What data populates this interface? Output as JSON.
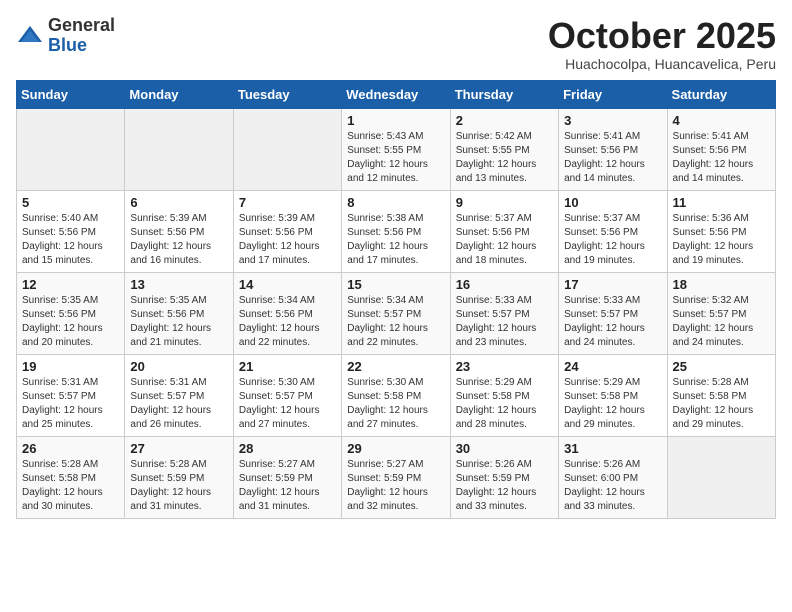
{
  "header": {
    "logo_general": "General",
    "logo_blue": "Blue",
    "month_title": "October 2025",
    "location": "Huachocolpa, Huancavelica, Peru"
  },
  "days_of_week": [
    "Sunday",
    "Monday",
    "Tuesday",
    "Wednesday",
    "Thursday",
    "Friday",
    "Saturday"
  ],
  "weeks": [
    [
      {
        "day": "",
        "info": ""
      },
      {
        "day": "",
        "info": ""
      },
      {
        "day": "",
        "info": ""
      },
      {
        "day": "1",
        "info": "Sunrise: 5:43 AM\nSunset: 5:55 PM\nDaylight: 12 hours\nand 12 minutes."
      },
      {
        "day": "2",
        "info": "Sunrise: 5:42 AM\nSunset: 5:55 PM\nDaylight: 12 hours\nand 13 minutes."
      },
      {
        "day": "3",
        "info": "Sunrise: 5:41 AM\nSunset: 5:56 PM\nDaylight: 12 hours\nand 14 minutes."
      },
      {
        "day": "4",
        "info": "Sunrise: 5:41 AM\nSunset: 5:56 PM\nDaylight: 12 hours\nand 14 minutes."
      }
    ],
    [
      {
        "day": "5",
        "info": "Sunrise: 5:40 AM\nSunset: 5:56 PM\nDaylight: 12 hours\nand 15 minutes."
      },
      {
        "day": "6",
        "info": "Sunrise: 5:39 AM\nSunset: 5:56 PM\nDaylight: 12 hours\nand 16 minutes."
      },
      {
        "day": "7",
        "info": "Sunrise: 5:39 AM\nSunset: 5:56 PM\nDaylight: 12 hours\nand 17 minutes."
      },
      {
        "day": "8",
        "info": "Sunrise: 5:38 AM\nSunset: 5:56 PM\nDaylight: 12 hours\nand 17 minutes."
      },
      {
        "day": "9",
        "info": "Sunrise: 5:37 AM\nSunset: 5:56 PM\nDaylight: 12 hours\nand 18 minutes."
      },
      {
        "day": "10",
        "info": "Sunrise: 5:37 AM\nSunset: 5:56 PM\nDaylight: 12 hours\nand 19 minutes."
      },
      {
        "day": "11",
        "info": "Sunrise: 5:36 AM\nSunset: 5:56 PM\nDaylight: 12 hours\nand 19 minutes."
      }
    ],
    [
      {
        "day": "12",
        "info": "Sunrise: 5:35 AM\nSunset: 5:56 PM\nDaylight: 12 hours\nand 20 minutes."
      },
      {
        "day": "13",
        "info": "Sunrise: 5:35 AM\nSunset: 5:56 PM\nDaylight: 12 hours\nand 21 minutes."
      },
      {
        "day": "14",
        "info": "Sunrise: 5:34 AM\nSunset: 5:56 PM\nDaylight: 12 hours\nand 22 minutes."
      },
      {
        "day": "15",
        "info": "Sunrise: 5:34 AM\nSunset: 5:57 PM\nDaylight: 12 hours\nand 22 minutes."
      },
      {
        "day": "16",
        "info": "Sunrise: 5:33 AM\nSunset: 5:57 PM\nDaylight: 12 hours\nand 23 minutes."
      },
      {
        "day": "17",
        "info": "Sunrise: 5:33 AM\nSunset: 5:57 PM\nDaylight: 12 hours\nand 24 minutes."
      },
      {
        "day": "18",
        "info": "Sunrise: 5:32 AM\nSunset: 5:57 PM\nDaylight: 12 hours\nand 24 minutes."
      }
    ],
    [
      {
        "day": "19",
        "info": "Sunrise: 5:31 AM\nSunset: 5:57 PM\nDaylight: 12 hours\nand 25 minutes."
      },
      {
        "day": "20",
        "info": "Sunrise: 5:31 AM\nSunset: 5:57 PM\nDaylight: 12 hours\nand 26 minutes."
      },
      {
        "day": "21",
        "info": "Sunrise: 5:30 AM\nSunset: 5:57 PM\nDaylight: 12 hours\nand 27 minutes."
      },
      {
        "day": "22",
        "info": "Sunrise: 5:30 AM\nSunset: 5:58 PM\nDaylight: 12 hours\nand 27 minutes."
      },
      {
        "day": "23",
        "info": "Sunrise: 5:29 AM\nSunset: 5:58 PM\nDaylight: 12 hours\nand 28 minutes."
      },
      {
        "day": "24",
        "info": "Sunrise: 5:29 AM\nSunset: 5:58 PM\nDaylight: 12 hours\nand 29 minutes."
      },
      {
        "day": "25",
        "info": "Sunrise: 5:28 AM\nSunset: 5:58 PM\nDaylight: 12 hours\nand 29 minutes."
      }
    ],
    [
      {
        "day": "26",
        "info": "Sunrise: 5:28 AM\nSunset: 5:58 PM\nDaylight: 12 hours\nand 30 minutes."
      },
      {
        "day": "27",
        "info": "Sunrise: 5:28 AM\nSunset: 5:59 PM\nDaylight: 12 hours\nand 31 minutes."
      },
      {
        "day": "28",
        "info": "Sunrise: 5:27 AM\nSunset: 5:59 PM\nDaylight: 12 hours\nand 31 minutes."
      },
      {
        "day": "29",
        "info": "Sunrise: 5:27 AM\nSunset: 5:59 PM\nDaylight: 12 hours\nand 32 minutes."
      },
      {
        "day": "30",
        "info": "Sunrise: 5:26 AM\nSunset: 5:59 PM\nDaylight: 12 hours\nand 33 minutes."
      },
      {
        "day": "31",
        "info": "Sunrise: 5:26 AM\nSunset: 6:00 PM\nDaylight: 12 hours\nand 33 minutes."
      },
      {
        "day": "",
        "info": ""
      }
    ]
  ]
}
